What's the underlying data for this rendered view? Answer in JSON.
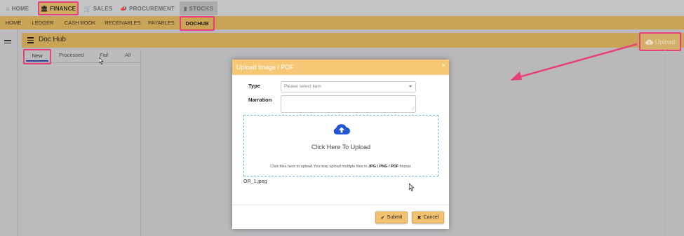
{
  "top_nav": [
    {
      "label": "HOME",
      "icon": "home-icon"
    },
    {
      "label": "FINANCE",
      "icon": "bank-icon",
      "active": true
    },
    {
      "label": "SALES",
      "icon": "cart-icon"
    },
    {
      "label": "PROCUREMENT",
      "icon": "megaphone-icon"
    },
    {
      "label": "STOCKS",
      "icon": "bar-chart-icon"
    }
  ],
  "sub_nav": [
    "HOME",
    "LEDGER",
    "CASH BOOK",
    "RECEIVABLES",
    "PAYABLES",
    "DOCHUB"
  ],
  "sub_nav_active": "DOCHUB",
  "page": {
    "title": "Doc Hub",
    "upload_label": "Upload"
  },
  "doc_tabs": [
    "New",
    "Processed",
    "Fail",
    "All"
  ],
  "modal": {
    "title": "Upload Image / PDF",
    "close": "×",
    "type_label": "Type",
    "type_placeholder": "Please select item",
    "narration_label": "Narration",
    "dropzone_title": "Click Here To Upload",
    "dropzone_hint_prefix": "Click files here to upload You may upload multiple files in",
    "dropzone_hint_formats": "JPG / PNG / PDF",
    "dropzone_hint_suffix": "format.",
    "file_name": "OR_1.jpeg",
    "submit_label": "Submit",
    "cancel_label": "Cancel"
  },
  "colors": {
    "accent_gold": "#c9a457",
    "highlight_pink": "#e8407a",
    "modal_header": "#f6c876",
    "cloud_blue": "#1f55d6"
  }
}
